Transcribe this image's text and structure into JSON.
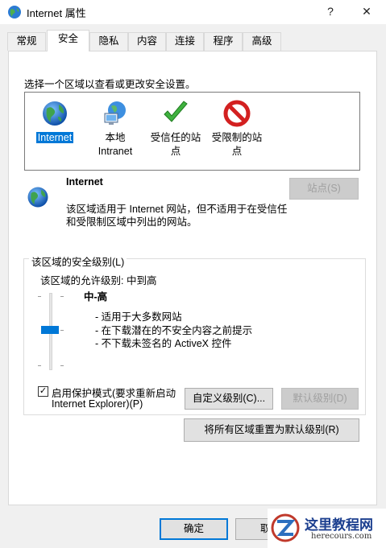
{
  "window": {
    "title": "Internet 属性",
    "help": "?",
    "close": "✕"
  },
  "tabs": [
    "常规",
    "安全",
    "隐私",
    "内容",
    "连接",
    "程序",
    "高级"
  ],
  "active_tab": "安全",
  "prompt": "选择一个区域以查看或更改安全设置。",
  "zones": [
    {
      "line1": "Internet",
      "line2": "",
      "icon": "globe-icon"
    },
    {
      "line1": "本地",
      "line2": "Intranet",
      "icon": "intranet-icon"
    },
    {
      "line1": "受信任的站",
      "line2": "点",
      "icon": "checkmark-icon"
    },
    {
      "line1": "受限制的站",
      "line2": "点",
      "icon": "restricted-icon"
    }
  ],
  "selected_zone": "Internet",
  "detail": {
    "title": "Internet",
    "desc_line1": "该区域适用于 Internet 网站，但不适用于在受信任",
    "desc_line2": "和受限制区域中列出的网站。",
    "sites_button": "站点(S)"
  },
  "security_level": {
    "group_label": "该区域的安全级别(L)",
    "allowed_label": "该区域的允许级别: 中到高",
    "level_name": "中-高",
    "bullets": [
      "- 适用于大多数网站",
      "- 在下载潜在的不安全内容之前提示",
      "- 不下载未签名的 ActiveX 控件"
    ],
    "slider_level_fraction": 0.5,
    "protected_mode_line1": "启用保护模式(要求重新启动",
    "protected_mode_line2": "Internet Explorer)(P)",
    "protected_mode_checked": true,
    "custom_level_button": "自定义级别(C)...",
    "default_level_button": "默认级别(D)"
  },
  "reset_all_button": "将所有区域重置为默认级别(R)",
  "footer": {
    "ok": "确定",
    "cancel": "取"
  },
  "watermark": {
    "brand": "这里教程网",
    "url": "herecours.com"
  },
  "colors": {
    "accent": "#0078d7",
    "panel": "#ffffff",
    "window": "#f0f0f0"
  }
}
